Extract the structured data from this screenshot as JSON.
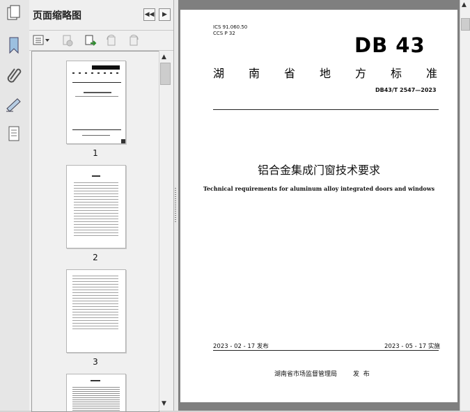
{
  "panel": {
    "title": "页面缩略图"
  },
  "thumbnails": [
    {
      "page_number": "1"
    },
    {
      "page_number": "2"
    },
    {
      "page_number": "3"
    }
  ],
  "document": {
    "ics": "ICS 91.060.50",
    "ccs": "CCS P 32",
    "logo_text": "DB 43",
    "authority_chars": [
      "湖",
      "南",
      "省",
      "地",
      "方",
      "标",
      "准"
    ],
    "standard_no": "DB43/T 2547—2023",
    "title_cn": "铝合金集成门窗技术要求",
    "title_en": "Technical requirements for aluminum alloy integrated doors and windows",
    "publish_date": "2023 - 02 - 17 发布",
    "implement_date": "2023 - 05 - 17 实施",
    "issuer": "湖南省市场监督管理局",
    "issue_word": "发  布"
  },
  "colors": {
    "background_gray": "#7f7f7f",
    "panel": "#f0f0f0"
  }
}
